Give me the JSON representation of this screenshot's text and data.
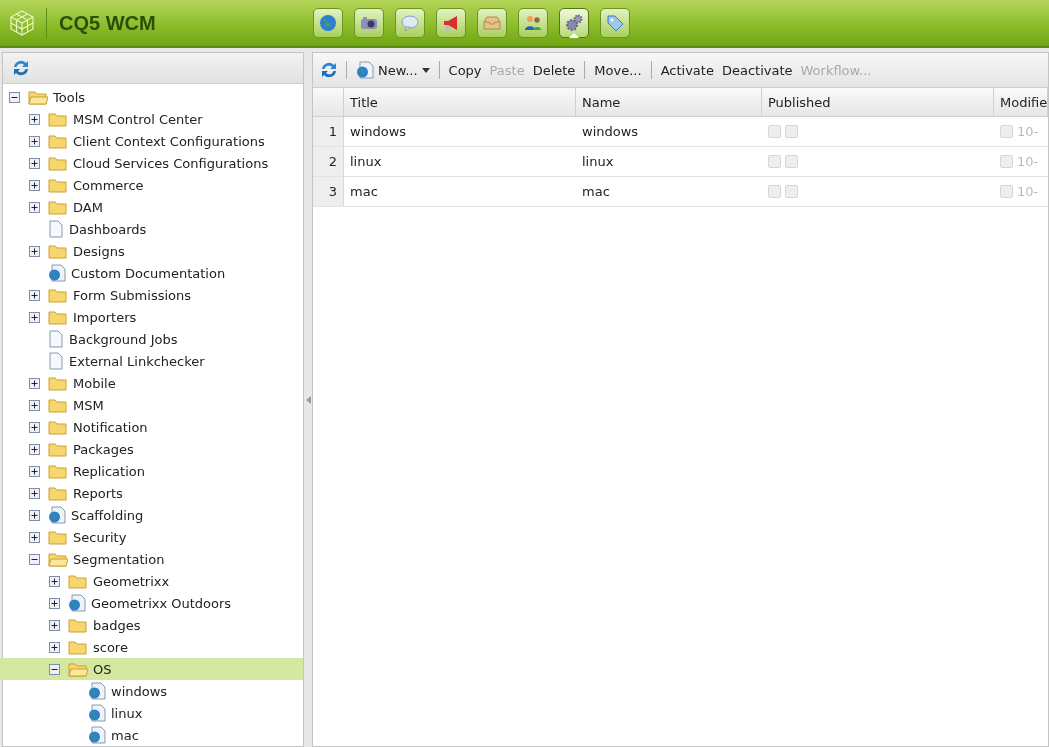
{
  "header": {
    "product": "CQ5 WCM"
  },
  "nav_icons": [
    {
      "kind": "globe",
      "selected": false
    },
    {
      "kind": "camera",
      "selected": false
    },
    {
      "kind": "bubble",
      "selected": false
    },
    {
      "kind": "megaphone",
      "selected": false
    },
    {
      "kind": "inbox",
      "selected": false
    },
    {
      "kind": "users",
      "selected": false
    },
    {
      "kind": "gears",
      "selected": true
    },
    {
      "kind": "tag",
      "selected": false
    }
  ],
  "tree": [
    {
      "label": "Tools",
      "kind": "folder",
      "expanded": true,
      "selected": false,
      "children": [
        {
          "label": "MSM Control Center",
          "kind": "folder",
          "expanded": false,
          "selected": false
        },
        {
          "label": "Client Context Configurations",
          "kind": "folder",
          "expanded": false,
          "selected": false
        },
        {
          "label": "Cloud Services Configurations",
          "kind": "folder",
          "expanded": false,
          "selected": false
        },
        {
          "label": "Commerce",
          "kind": "folder",
          "expanded": false,
          "selected": false
        },
        {
          "label": "DAM",
          "kind": "folder",
          "expanded": false,
          "selected": false
        },
        {
          "label": "Dashboards",
          "kind": "page",
          "selected": false
        },
        {
          "label": "Designs",
          "kind": "folder",
          "expanded": false,
          "selected": false
        },
        {
          "label": "Custom Documentation",
          "kind": "webpage",
          "selected": false
        },
        {
          "label": "Form Submissions",
          "kind": "folder",
          "expanded": false,
          "selected": false
        },
        {
          "label": "Importers",
          "kind": "folder",
          "expanded": false,
          "selected": false
        },
        {
          "label": "Background Jobs",
          "kind": "page",
          "selected": false
        },
        {
          "label": "External Linkchecker",
          "kind": "page",
          "selected": false
        },
        {
          "label": "Mobile",
          "kind": "folder",
          "expanded": false,
          "selected": false
        },
        {
          "label": "MSM",
          "kind": "folder",
          "expanded": false,
          "selected": false
        },
        {
          "label": "Notification",
          "kind": "folder",
          "expanded": false,
          "selected": false
        },
        {
          "label": "Packages",
          "kind": "folder",
          "expanded": false,
          "selected": false
        },
        {
          "label": "Replication",
          "kind": "folder",
          "expanded": false,
          "selected": false
        },
        {
          "label": "Reports",
          "kind": "folder",
          "expanded": false,
          "selected": false
        },
        {
          "label": "Scaffolding",
          "kind": "webpage",
          "expanded": false,
          "selected": false
        },
        {
          "label": "Security",
          "kind": "folder",
          "expanded": false,
          "selected": false
        },
        {
          "label": "Segmentation",
          "kind": "folder",
          "expanded": true,
          "selected": false,
          "children": [
            {
              "label": "Geometrixx",
              "kind": "folder",
              "expanded": false,
              "selected": false
            },
            {
              "label": "Geometrixx Outdoors",
              "kind": "webpage",
              "expanded": false,
              "selected": false
            },
            {
              "label": "badges",
              "kind": "folder",
              "expanded": false,
              "selected": false
            },
            {
              "label": "score",
              "kind": "folder",
              "expanded": false,
              "selected": false
            },
            {
              "label": "OS",
              "kind": "folder",
              "expanded": true,
              "selected": true,
              "children": [
                {
                  "label": "windows",
                  "kind": "webpage",
                  "selected": false
                },
                {
                  "label": "linux",
                  "kind": "webpage",
                  "selected": false
                },
                {
                  "label": "mac",
                  "kind": "webpage",
                  "selected": false
                }
              ]
            }
          ]
        }
      ]
    }
  ],
  "toolbar": [
    {
      "kind": "refresh"
    },
    {
      "kind": "separator"
    },
    {
      "kind": "menu",
      "label": "New...",
      "disabled": false
    },
    {
      "kind": "separator"
    },
    {
      "kind": "button",
      "label": "Copy",
      "disabled": false
    },
    {
      "kind": "button",
      "label": "Paste",
      "disabled": true
    },
    {
      "kind": "button",
      "label": "Delete",
      "disabled": false
    },
    {
      "kind": "separator"
    },
    {
      "kind": "button",
      "label": "Move...",
      "disabled": false
    },
    {
      "kind": "separator"
    },
    {
      "kind": "button",
      "label": "Activate",
      "disabled": false
    },
    {
      "kind": "button",
      "label": "Deactivate",
      "disabled": false
    },
    {
      "kind": "button",
      "label": "Workflow...",
      "disabled": true
    }
  ],
  "table": {
    "columns": [
      "Title",
      "Name",
      "Published",
      "Modifie"
    ],
    "rows": [
      {
        "number": "1",
        "title": "windows",
        "name": "windows",
        "modified": "10-"
      },
      {
        "number": "2",
        "title": "linux",
        "name": "linux",
        "modified": "10-"
      },
      {
        "number": "3",
        "title": "mac",
        "name": "mac",
        "modified": "10-"
      }
    ]
  }
}
